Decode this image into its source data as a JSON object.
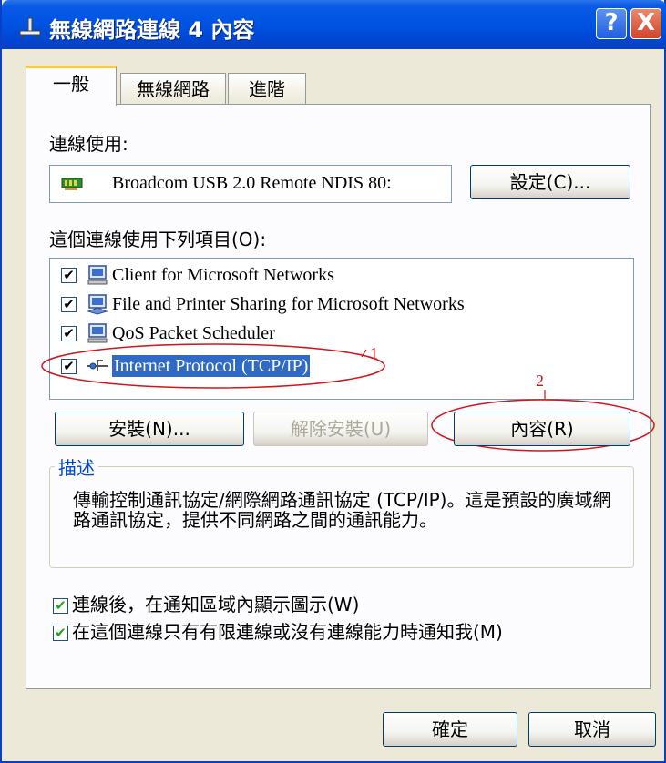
{
  "window": {
    "title": "無線網路連線 4 內容",
    "help_label": "?",
    "close_label": "X"
  },
  "tabs": [
    {
      "label": "一般"
    },
    {
      "label": "無線網路"
    },
    {
      "label": "進階"
    }
  ],
  "connect_using": {
    "label": "連線使用:",
    "adapter": "Broadcom USB 2.0 Remote NDIS 80:",
    "configure_button": "設定(C)..."
  },
  "items_section": {
    "label": "這個連線使用下列項目(O):",
    "items": [
      {
        "label": "Client for Microsoft Networks",
        "checked": true,
        "icon": "network-client-icon"
      },
      {
        "label": "File and Printer Sharing for Microsoft Networks",
        "checked": true,
        "icon": "file-printer-sharing-icon"
      },
      {
        "label": "QoS Packet Scheduler",
        "checked": true,
        "icon": "qos-scheduler-icon"
      },
      {
        "label": "Internet Protocol (TCP/IP)",
        "checked": true,
        "selected": true,
        "icon": "protocol-icon"
      }
    ]
  },
  "buttons": {
    "install": "安裝(N)...",
    "uninstall": "解除安裝(U)",
    "properties": "內容(R)",
    "ok": "確定",
    "cancel": "取消"
  },
  "description": {
    "title": "描述",
    "text": "傳輸控制通訊協定/網際網路通訊協定 (TCP/IP)。這是預設的廣域網路通訊協定，提供不同網路之間的通訊能力。"
  },
  "options": [
    {
      "label": "連線後，在通知區域內顯示圖示(W)",
      "checked": true
    },
    {
      "label": "在這個連線只有有限連線或沒有連線能力時通知我(M)",
      "checked": true
    }
  ],
  "annotations": {
    "marker_1": "1",
    "marker_2": "2",
    "color": "#d0161b"
  }
}
